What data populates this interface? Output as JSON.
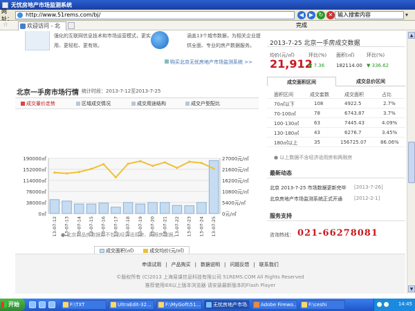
{
  "window": {
    "title": "无忧房地产市场监测系统"
  },
  "address": {
    "label": "网址：",
    "url": "http://www.51rems.com/bj/",
    "search_placeholder": "输入搜索内容"
  },
  "tabbar": {
    "tab_title": "欢迎访问 - 北",
    "status": "完成"
  },
  "promo": {
    "left_text": "强化的互联网信息技术和市场运营模式，更实用、更轻松、更有效。",
    "right_text": "涵盖13个城市数据，为相关企业提供全面、专业的房产数据服务。",
    "link": "购买北京无忧房地产市场监测系统 >>"
  },
  "market": {
    "title": "北京一手房市场行情",
    "period": "统计时段：2013-7-12至2013-7-25",
    "subtabs": [
      "成交量价走势",
      "区域成交情况",
      "成交用途结构",
      "成交户型配比"
    ],
    "active_subtab": 0,
    "note": "北京商品房数据库不包括经济适用房、两限房数据。"
  },
  "chart_data": {
    "type": "bar+line",
    "categories": [
      "13-07-12",
      "13-07-13",
      "13-07-14",
      "13-07-15",
      "13-07-16",
      "13-07-17",
      "13-07-18",
      "13-07-19",
      "13-07-20",
      "13-07-21",
      "13-07-22",
      "13-07-23",
      "13-07-24",
      "13-07-25"
    ],
    "y_left_ticks": [
      "190000㎡",
      "152000㎡",
      "114000㎡",
      "76000㎡",
      "38000㎡",
      "0㎡"
    ],
    "y_right_ticks": [
      "27000元/㎡",
      "21600元/㎡",
      "16200元/㎡",
      "10800元/㎡",
      "5400元/㎡",
      "0元/㎡"
    ],
    "ylim_left": [
      0,
      190000
    ],
    "ylim_right": [
      0,
      27000
    ],
    "series": [
      {
        "name": "成交面积(㎡)",
        "kind": "bar",
        "color": "#c5dcf2",
        "values": [
          48000,
          43000,
          33000,
          33000,
          36000,
          22000,
          38000,
          33000,
          38000,
          38000,
          28000,
          27000,
          38000,
          182114
        ]
      },
      {
        "name": "成交均价(元/㎡)",
        "kind": "line",
        "color": "#f0c030",
        "values": [
          20000,
          19600,
          20300,
          21800,
          24100,
          17700,
          24300,
          25600,
          23300,
          25000,
          22300,
          25300,
          24700,
          21912
        ]
      }
    ],
    "legend_position": "bottom"
  },
  "right": {
    "date_title": "2013-7-25  北京一手房成交数据",
    "labels": [
      "均价(元/㎡)",
      "环比(%)",
      "面积(㎡)",
      "环比(%)"
    ],
    "price": "21,912",
    "price_chg": "7.36",
    "area": "182114.00",
    "area_chg": "336.62",
    "tabs": [
      "成交面积区间",
      "成交总价区间"
    ],
    "table_header": [
      "面积区间",
      "成交套数",
      "成交面积",
      "占比"
    ],
    "table_rows": [
      [
        "70㎡以下",
        "108",
        "4922.5",
        "2.7%"
      ],
      [
        "70-100㎡",
        "78",
        "6743.87",
        "3.7%"
      ],
      [
        "100-130㎡",
        "63",
        "7445.43",
        "4.09%"
      ],
      [
        "130-180㎡",
        "43",
        "6276.7",
        "3.45%"
      ],
      [
        "180㎡以上",
        "35",
        "156725.07",
        "86.06%"
      ]
    ],
    "table_note": "以上数据不含经济适用房和两限房",
    "news_title": "最新动态",
    "news": [
      {
        "text": "北京 2013-7-25 市场数据更新完毕",
        "date": "[2013-7-26]"
      },
      {
        "text": "北京房地产市场监测系统正式开通",
        "date": "[2012-2-1]"
      }
    ],
    "service_title": "服务支持",
    "hotline_label": "咨询热线：",
    "hotline": "021-66278081"
  },
  "footer": {
    "links": [
      "申请试用",
      "|",
      "产品购买",
      "|",
      "数据说明",
      "|",
      "问题反馈",
      "|",
      "联系我们"
    ],
    "copyright": "©版权所有 (C)2013 上海易谋信息科技有限公司 51REMS.COM All Rights Reserved",
    "browser_note": "推荐使用IE6以上版本浏览器 请安装最新版本的Flash Player"
  },
  "taskbar": {
    "start": "开始",
    "buttons": [
      "F:\\TXT",
      "UltraEdit-32...",
      "F:\\MyGoft\\51...",
      "无忧房地产市场...",
      "Adobe Firewo...",
      "F:\\ceshi"
    ],
    "active": 3,
    "time": "14:45"
  }
}
